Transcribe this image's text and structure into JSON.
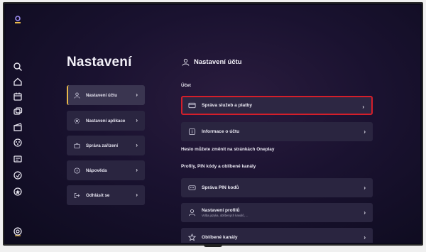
{
  "left_menu": {
    "title": "Nastavení",
    "items": [
      {
        "label": "Nastavení účtu",
        "active": true
      },
      {
        "label": "Nastavení aplikace",
        "active": false
      },
      {
        "label": "Správa zařízení",
        "active": false
      },
      {
        "label": "Nápověda",
        "active": false
      },
      {
        "label": "Odhlásit se",
        "active": false
      }
    ]
  },
  "right_panel": {
    "heading": "Nastavení účtu",
    "section_account": "Účet",
    "rows_account": [
      {
        "label": "Správa služeb a platby",
        "focused": true
      },
      {
        "label": "Informace o účtu",
        "focused": false
      }
    ],
    "password_note": "Heslo můžete změnit na stránkách Oneplay",
    "section_profiles": "Profily, PIN kódy a oblíbené kanály",
    "rows_profiles": [
      {
        "label": "Správa PIN kodů"
      },
      {
        "label": "Nastavení profilů",
        "sub": "Volba jazyka, oblíbených kanálů, ..."
      },
      {
        "label": "Oblíbené kanály"
      }
    ]
  },
  "rail_icons": [
    "logo-icon",
    "search-icon",
    "home-icon",
    "tv-guide-icon",
    "channels-icon",
    "movies-icon",
    "series-icon",
    "library-icon",
    "sport-icon",
    "kids-icon",
    "settings-icon"
  ],
  "colors": {
    "focus": "#d51e2a",
    "accent": "#e8b84a",
    "tile": "#2a2540"
  }
}
